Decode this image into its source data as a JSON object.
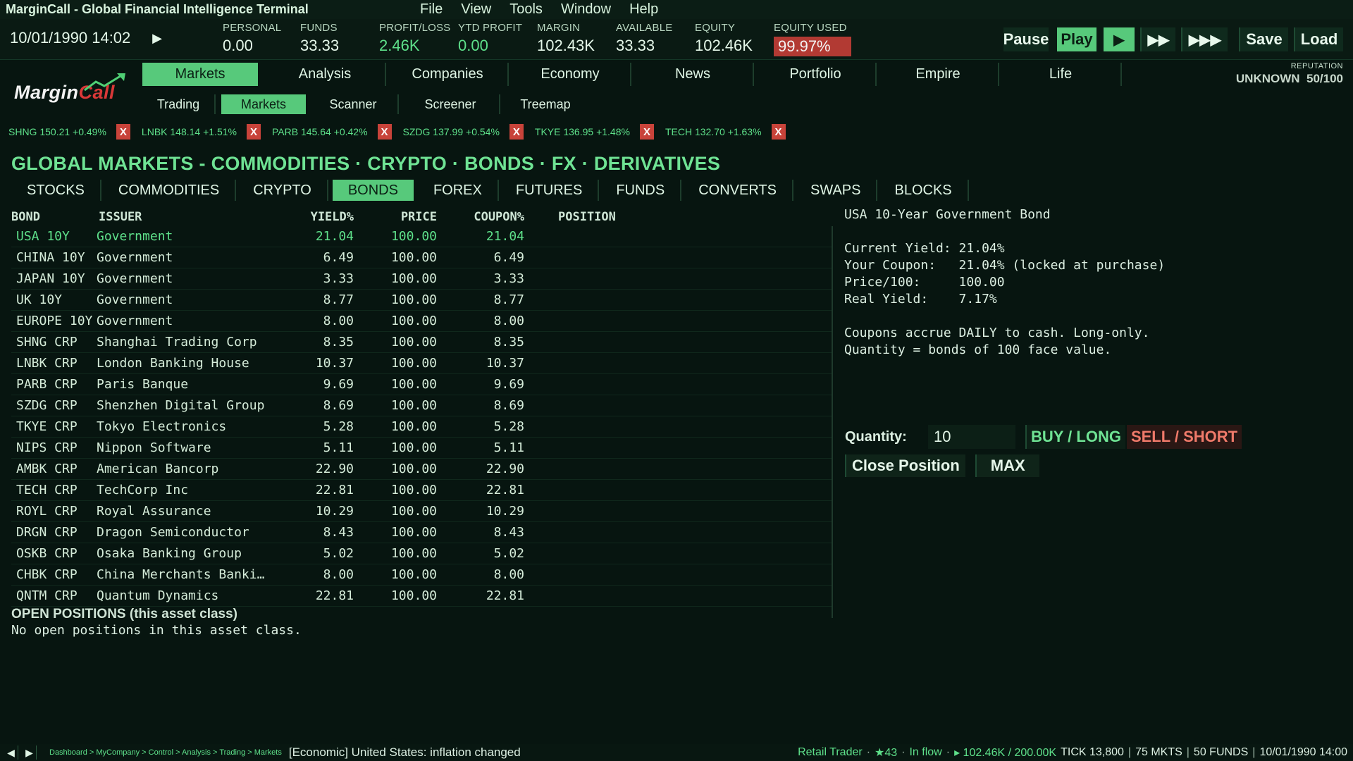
{
  "app": {
    "title": "MarginCall - Global Financial Intelligence Terminal",
    "menu": [
      "File",
      "View",
      "Tools",
      "Window",
      "Help"
    ]
  },
  "topbar": {
    "datetime": "10/01/1990 14:02",
    "stats": [
      {
        "label": "PERSONAL",
        "value": "0.00",
        "tone": "white"
      },
      {
        "label": "FUNDS",
        "value": "33.33",
        "tone": "white"
      },
      {
        "label": "PROFIT/LOSS",
        "value": "2.46K",
        "tone": "green"
      },
      {
        "label": "YTD PROFIT",
        "value": "0.00",
        "tone": "green"
      },
      {
        "label": "MARGIN",
        "value": "102.43K",
        "tone": "white"
      },
      {
        "label": "AVAILABLE",
        "value": "33.33",
        "tone": "white"
      },
      {
        "label": "EQUITY",
        "value": "102.46K",
        "tone": "white"
      },
      {
        "label": "EQUITY USED",
        "value": "99.97%",
        "tone": "alert"
      }
    ],
    "controls": {
      "pause": "Pause",
      "play": "Play",
      "speed1": "▶",
      "speed2": "▶▶",
      "speed3": "▶▶▶",
      "save": "Save",
      "load": "Load"
    }
  },
  "logo": {
    "margin": "Margin",
    "call": "Call"
  },
  "nav": {
    "main": [
      "Markets",
      "Analysis",
      "Companies",
      "Economy",
      "News",
      "Portfolio",
      "Empire",
      "Life"
    ],
    "main_active": 0,
    "sub": [
      "Trading",
      "Markets",
      "Scanner",
      "Screener",
      "Treemap"
    ],
    "sub_active": 1
  },
  "reputation": {
    "label": "REPUTATION",
    "status": "UNKNOWN",
    "score": "50/100"
  },
  "watchlist": [
    {
      "text": "SHNG 150.21 +0.49%",
      "remove": "X"
    },
    {
      "text": "LNBK 148.14 +1.51%",
      "remove": "X"
    },
    {
      "text": "PARB 145.64 +0.42%",
      "remove": "X"
    },
    {
      "text": "SZDG 137.99 +0.54%",
      "remove": "X"
    },
    {
      "text": "TKYE 136.95 +1.48%",
      "remove": "X"
    },
    {
      "text": "TECH 132.70 +1.63%",
      "remove": "X"
    }
  ],
  "page": {
    "title": "GLOBAL MARKETS - COMMODITIES · CRYPTO · BONDS · FX · DERIVATIVES",
    "asset_tabs": [
      "STOCKS",
      "COMMODITIES",
      "CRYPTO",
      "BONDS",
      "FOREX",
      "FUTURES",
      "FUNDS",
      "CONVERTS",
      "SWAPS",
      "BLOCKS"
    ],
    "asset_active": 3
  },
  "table": {
    "headers": {
      "bond": "BOND",
      "issuer": "ISSUER",
      "yield": "YIELD%",
      "price": "PRICE",
      "coupon": "COUPON%",
      "position": "POSITION"
    },
    "rows": [
      {
        "bond": "USA 10Y",
        "issuer": "Government",
        "yield": "21.04",
        "price": "100.00",
        "coupon": "21.04",
        "position": ""
      },
      {
        "bond": "CHINA 10Y",
        "issuer": "Government",
        "yield": "6.49",
        "price": "100.00",
        "coupon": "6.49",
        "position": ""
      },
      {
        "bond": "JAPAN 10Y",
        "issuer": "Government",
        "yield": "3.33",
        "price": "100.00",
        "coupon": "3.33",
        "position": ""
      },
      {
        "bond": "UK 10Y",
        "issuer": "Government",
        "yield": "8.77",
        "price": "100.00",
        "coupon": "8.77",
        "position": ""
      },
      {
        "bond": "EUROPE 10Y",
        "issuer": "Government",
        "yield": "8.00",
        "price": "100.00",
        "coupon": "8.00",
        "position": ""
      },
      {
        "bond": "SHNG CRP",
        "issuer": "Shanghai Trading Corp",
        "yield": "8.35",
        "price": "100.00",
        "coupon": "8.35",
        "position": ""
      },
      {
        "bond": "LNBK CRP",
        "issuer": "London Banking House",
        "yield": "10.37",
        "price": "100.00",
        "coupon": "10.37",
        "position": ""
      },
      {
        "bond": "PARB CRP",
        "issuer": "Paris Banque",
        "yield": "9.69",
        "price": "100.00",
        "coupon": "9.69",
        "position": ""
      },
      {
        "bond": "SZDG CRP",
        "issuer": "Shenzhen Digital Group",
        "yield": "8.69",
        "price": "100.00",
        "coupon": "8.69",
        "position": ""
      },
      {
        "bond": "TKYE CRP",
        "issuer": "Tokyo Electronics",
        "yield": "5.28",
        "price": "100.00",
        "coupon": "5.28",
        "position": ""
      },
      {
        "bond": "NIPS CRP",
        "issuer": "Nippon Software",
        "yield": "5.11",
        "price": "100.00",
        "coupon": "5.11",
        "position": ""
      },
      {
        "bond": "AMBK CRP",
        "issuer": "American Bancorp",
        "yield": "22.90",
        "price": "100.00",
        "coupon": "22.90",
        "position": ""
      },
      {
        "bond": "TECH CRP",
        "issuer": "TechCorp Inc",
        "yield": "22.81",
        "price": "100.00",
        "coupon": "22.81",
        "position": ""
      },
      {
        "bond": "ROYL CRP",
        "issuer": "Royal Assurance",
        "yield": "10.29",
        "price": "100.00",
        "coupon": "10.29",
        "position": ""
      },
      {
        "bond": "DRGN CRP",
        "issuer": "Dragon Semiconductor",
        "yield": "8.43",
        "price": "100.00",
        "coupon": "8.43",
        "position": ""
      },
      {
        "bond": "OSKB CRP",
        "issuer": "Osaka Banking Group",
        "yield": "5.02",
        "price": "100.00",
        "coupon": "5.02",
        "position": ""
      },
      {
        "bond": "CHBK CRP",
        "issuer": "China Merchants Banki…",
        "yield": "8.00",
        "price": "100.00",
        "coupon": "8.00",
        "position": ""
      },
      {
        "bond": "QNTM CRP",
        "issuer": "Quantum Dynamics",
        "yield": "22.81",
        "price": "100.00",
        "coupon": "22.81",
        "position": ""
      }
    ],
    "selected_index": 0
  },
  "detail": {
    "lines": [
      "USA 10-Year Government Bond",
      "",
      "Current Yield: 21.04%",
      "Your Coupon:   21.04% (locked at purchase)",
      "Price/100:     100.00",
      "Real Yield:    7.17%",
      "",
      "Coupons accrue DAILY to cash. Long-only.",
      "Quantity = bonds of 100 face value."
    ]
  },
  "trade": {
    "quantity_label": "Quantity:",
    "quantity_value": "10",
    "buy_label": "BUY / LONG",
    "sell_label": "SELL / SHORT",
    "close_label": "Close Position",
    "max_label": "MAX"
  },
  "open_positions": {
    "title": "OPEN POSITIONS (this asset class)",
    "empty": "No open positions in this asset class."
  },
  "statusbar": {
    "back": "◀",
    "forward": "▶",
    "breadcrumb": "Dashboard > MyCompany > Control > Analysis > Trading > Markets",
    "news": "[Economic] United States: inflation changed",
    "trader": "Retail Trader",
    "stars": "★43",
    "flow": "In flow",
    "capacity": "▸ 102.46K / 200.00K",
    "tick": "TICK 13,800",
    "mkts": "75 MKTS",
    "funds": "50 FUNDS",
    "time": "10/01/1990 14:00"
  }
}
